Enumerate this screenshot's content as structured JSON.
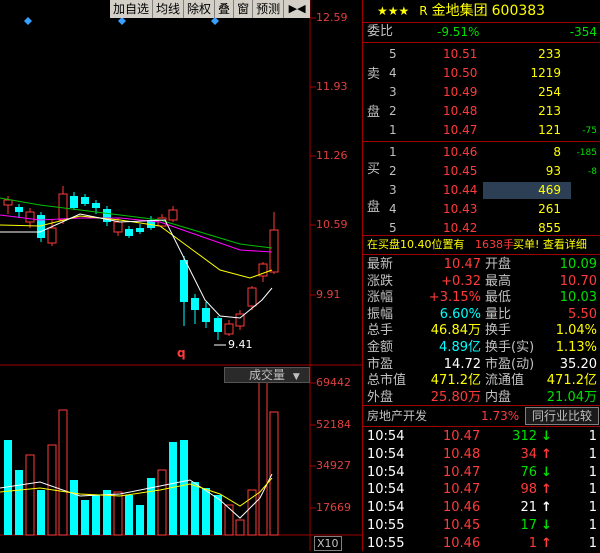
{
  "toolbar": {
    "items": [
      "加自选",
      "均线",
      "除权",
      "叠",
      "窗",
      "预测"
    ],
    "arrow": "▶◀"
  },
  "chart": {
    "price_labels": [
      "12.59",
      "11.93",
      "11.26",
      "10.59",
      "9.91"
    ],
    "low_marker": "9.41",
    "q_marker": "q",
    "volume_tab": "成交量",
    "volume_labels": [
      "69442",
      "52184",
      "34927",
      "17669"
    ],
    "x10": "X10",
    "colors": {
      "up": "#ff3b3b",
      "down": "#00ffff",
      "ma5": "#ffffff",
      "ma10": "#ffff00",
      "ma20": "#ff00ff",
      "ma30": "#00c000"
    }
  },
  "chart_data": {
    "type": "candlestick",
    "price_axis": [
      12.59,
      11.93,
      11.26,
      10.59,
      9.91
    ],
    "low_label": 9.41,
    "volume_axis": [
      69442,
      52184,
      34927,
      17669
    ]
  },
  "quote": {
    "stars": "★★★",
    "prefix": "R",
    "name": "金地集团",
    "code": "600383",
    "weibi_label": "委比",
    "weibi_pct": "-9.51%",
    "weibi_diff": "-354",
    "sell_label": [
      "卖",
      "盘"
    ],
    "buy_label": [
      "买",
      "盘"
    ],
    "sells": [
      {
        "lvl": "5",
        "price": "10.51",
        "vol": "233",
        "chg": ""
      },
      {
        "lvl": "4",
        "price": "10.50",
        "vol": "1219",
        "chg": ""
      },
      {
        "lvl": "3",
        "price": "10.49",
        "vol": "254",
        "chg": ""
      },
      {
        "lvl": "2",
        "price": "10.48",
        "vol": "213",
        "chg": ""
      },
      {
        "lvl": "1",
        "price": "10.47",
        "vol": "121",
        "chg": "-75"
      }
    ],
    "buys": [
      {
        "lvl": "1",
        "price": "10.46",
        "vol": "8",
        "chg": "-185"
      },
      {
        "lvl": "2",
        "price": "10.45",
        "vol": "93",
        "chg": "-8"
      },
      {
        "lvl": "3",
        "price": "10.44",
        "vol": "469",
        "chg": ""
      },
      {
        "lvl": "4",
        "price": "10.43",
        "vol": "261",
        "chg": ""
      },
      {
        "lvl": "5",
        "price": "10.42",
        "vol": "855",
        "chg": ""
      }
    ],
    "notice_text": "在买盘10.40位置有",
    "notice_vol": "1638手",
    "notice_link": "买单! 查看详细",
    "stats": [
      {
        "l1": "最新",
        "v1": "10.47",
        "c1": "red",
        "l2": "开盘",
        "v2": "10.09",
        "c2": "green"
      },
      {
        "l1": "涨跌",
        "v1": "+0.32",
        "c1": "red",
        "l2": "最高",
        "v2": "10.70",
        "c2": "red"
      },
      {
        "l1": "涨幅",
        "v1": "+3.15%",
        "c1": "red",
        "l2": "最低",
        "v2": "10.03",
        "c2": "green"
      },
      {
        "l1": "振幅",
        "v1": "6.60%",
        "c1": "cyan",
        "l2": "量比",
        "v2": "5.50",
        "c2": "red"
      },
      {
        "l1": "总手",
        "v1": "46.84万",
        "c1": "yellow",
        "l2": "换手",
        "v2": "1.04%",
        "c2": "yellow"
      },
      {
        "l1": "金额",
        "v1": "4.89亿",
        "c1": "cyan",
        "l2": "换手(实)",
        "v2": "1.13%",
        "c2": "yellow"
      },
      {
        "l1": "市盈",
        "v1": "14.72",
        "c1": "white",
        "l2": "市盈(动)",
        "v2": "35.20",
        "c2": "white"
      },
      {
        "l1": "总市值",
        "v1": "471.2亿",
        "c1": "yellow",
        "l2": "流通值",
        "v2": "471.2亿",
        "c2": "yellow"
      },
      {
        "l1": "外盘",
        "v1": "25.80万",
        "c1": "red",
        "l2": "内盘",
        "v2": "21.04万",
        "c2": "green"
      }
    ],
    "sector_name": "房地产开发",
    "sector_pct": "1.73%",
    "sector_btn": "同行业比较",
    "ticks": [
      {
        "t": "10:54",
        "p": "10.47",
        "v": "312",
        "a": "↓",
        "ac": "green",
        "n": "1"
      },
      {
        "t": "10:54",
        "p": "10.48",
        "v": "34",
        "a": "↑",
        "ac": "red",
        "n": "1"
      },
      {
        "t": "10:54",
        "p": "10.47",
        "v": "76",
        "a": "↓",
        "ac": "green",
        "n": "1"
      },
      {
        "t": "10:54",
        "p": "10.47",
        "v": "98",
        "a": "↑",
        "ac": "red",
        "n": "1"
      },
      {
        "t": "10:54",
        "p": "10.46",
        "v": "21",
        "a": "↑",
        "ac": "white",
        "n": "1"
      },
      {
        "t": "10:55",
        "p": "10.45",
        "v": "17",
        "a": "↓",
        "ac": "green",
        "n": "1"
      },
      {
        "t": "10:55",
        "p": "10.46",
        "v": "1",
        "a": "↑",
        "ac": "red",
        "n": "1"
      }
    ]
  }
}
